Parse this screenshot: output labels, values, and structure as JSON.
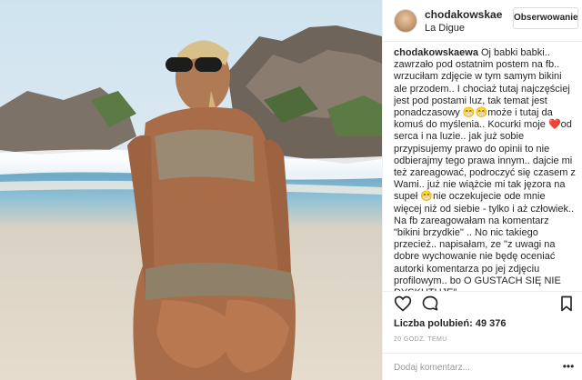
{
  "post": {
    "username": "chodakowskaewa",
    "username_truncated": "chodakowskae",
    "location": "La Digue",
    "follow_label": "Obserwowanie",
    "caption_text": " Oj babki babki.. zawrzało pod ostatnim postem na fb.. wrzuciłam zdjęcie w tym samym bikini ale przodem.. I chociaż tutaj najczęściej jest pod postami luz, tak temat jest ponadczasowy 😁😁może i tutaj da komuś do myślenia.. Kocurki moje ❤️od serca i na luzie.. jak już sobie przypisujemy prawo do opinii to nie odbierajmy tego prawa innym.. dajcie mi też zareagować, podroczyć się czasem z Wami.. już nie wiążcie mi tak jęzora na supeł 😁nie oczekujecie ode mnie więcej niż od siebie - tylko i aż człowiek.. Na fb zareagowałam na komentarz \"bikini brzydkie\" .. No nic takiego przecież.. napisałam, ze \"z uwagi na dobre wychowanie nie będę oceniać autorki komentarza po jej zdjęciu profilowym.. bo O GUSTACH SIĘ NIE DYSKUTUJE\"",
    "likes_label": "Liczba polubień: 49 376",
    "timestamp": "20 GODZ. TEMU",
    "comment_placeholder": "Dodaj komentarz...",
    "more_glyph": "•••"
  },
  "icons": {
    "like": "heart-outline-icon",
    "comment": "speech-bubble-icon",
    "save": "bookmark-icon",
    "more": "more-options-icon"
  },
  "colors": {
    "text": "#262626",
    "muted": "#999999",
    "border": "#dbdbdb",
    "divider": "#efefef"
  }
}
